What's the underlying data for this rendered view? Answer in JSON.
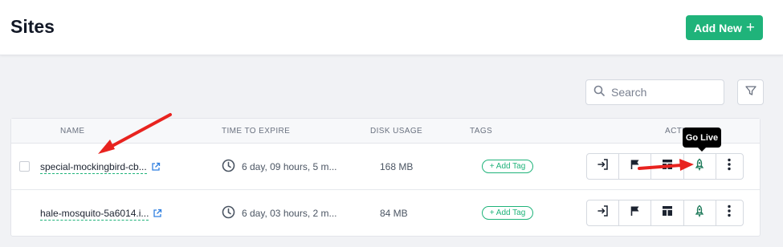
{
  "header": {
    "title": "Sites",
    "add_new_label": "Add New",
    "add_new_icon": "plus-icon"
  },
  "toolbar": {
    "search_placeholder": "Search",
    "filter_icon": "filter-icon"
  },
  "table": {
    "columns": [
      "NAME",
      "TIME TO EXPIRE",
      "DISK USAGE",
      "TAGS",
      "ACTIONS"
    ],
    "rows": [
      {
        "name": "special-mockingbird-cb...",
        "time_to_expire": "6 day, 09 hours, 5 m...",
        "disk_usage": "168 MB",
        "tag_label": "+ Add Tag"
      },
      {
        "name": "hale-mosquito-5a6014.i...",
        "time_to_expire": "6 day, 03 hours, 2 m...",
        "disk_usage": "84 MB",
        "tag_label": "+ Add Tag"
      }
    ],
    "action_icons": [
      "login-icon",
      "flag-icon",
      "layout-icon",
      "rocket-icon",
      "more-vertical-icon"
    ]
  },
  "tooltip": {
    "text": "Go Live"
  },
  "colors": {
    "accent": "#1fb37a",
    "annotation_arrow": "#e8231f",
    "tooltip_bg": "#000000"
  }
}
